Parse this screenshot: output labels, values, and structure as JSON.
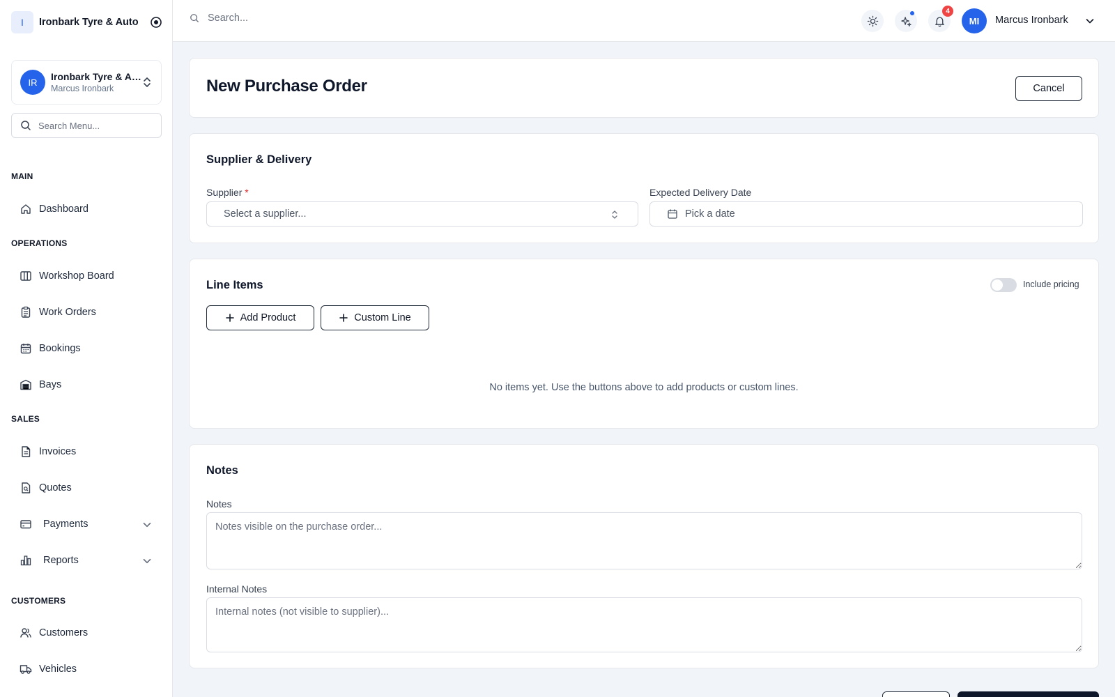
{
  "brand": {
    "logo_letter": "I",
    "name": "Ironbark Tyre & Auto"
  },
  "org": {
    "initials": "IR",
    "name": "Ironbark Tyre & Auto",
    "user": "Marcus Ironbark"
  },
  "menu_search": {
    "placeholder": "Search Menu..."
  },
  "sidebar": {
    "sections": {
      "main": "MAIN",
      "operations": "OPERATIONS",
      "sales": "SALES",
      "customers": "CUSTOMERS"
    },
    "items": {
      "dashboard": "Dashboard",
      "workshop_board": "Workshop Board",
      "work_orders": "Work Orders",
      "bookings": "Bookings",
      "bays": "Bays",
      "invoices": "Invoices",
      "quotes": "Quotes",
      "payments": "Payments",
      "reports": "Reports",
      "customers": "Customers",
      "vehicles": "Vehicles"
    }
  },
  "topbar": {
    "search_placeholder": "Search...",
    "notification_count": "4",
    "user_initials": "MI",
    "user_name": "Marcus Ironbark"
  },
  "page": {
    "title": "New Purchase Order",
    "cancel_label": "Cancel"
  },
  "supplier_delivery": {
    "title": "Supplier & Delivery",
    "supplier_label": "Supplier",
    "required_mark": "*",
    "supplier_placeholder": "Select a supplier...",
    "delivery_label": "Expected Delivery Date",
    "delivery_placeholder": "Pick a date"
  },
  "line_items": {
    "title": "Line Items",
    "include_pricing_label": "Include pricing",
    "include_pricing_on": false,
    "add_product_label": "Add Product",
    "custom_line_label": "Custom Line",
    "empty_message": "No items yet. Use the buttons above to add products or custom lines."
  },
  "notes": {
    "title": "Notes",
    "notes_label": "Notes",
    "notes_placeholder": "Notes visible on the purchase order...",
    "internal_label": "Internal Notes",
    "internal_placeholder": "Internal notes (not visible to supplier)..."
  },
  "colors": {
    "accent": "#2563eb",
    "danger": "#ef4444",
    "background": "#f1f4f8",
    "primary_dark": "#0f172a"
  }
}
